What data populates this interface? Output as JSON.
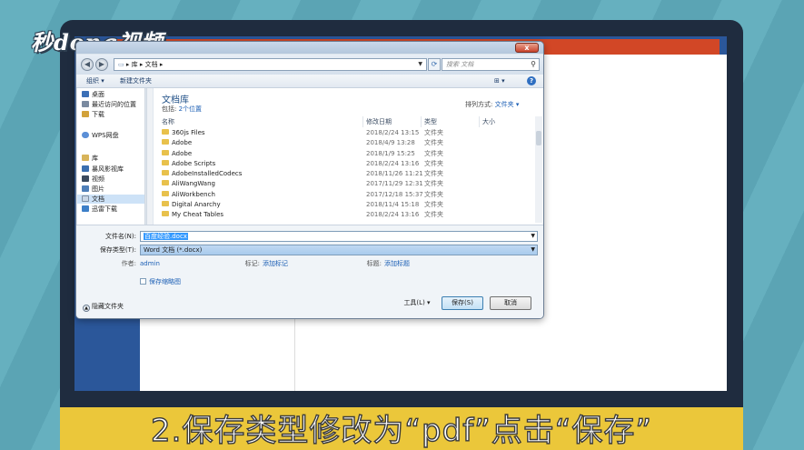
{
  "logo": "秒dong视频",
  "caption": "2.保存类型修改为“pdf”点击“保存”",
  "dialog": {
    "close": "x",
    "address": {
      "path": [
        "库",
        "文档"
      ],
      "separator": "▸"
    },
    "search_placeholder": "搜索 文档",
    "toolbar": {
      "organize": "组织 ▾",
      "new_folder": "新建文件夹",
      "view": "⊞ ▾",
      "help": "?"
    },
    "nav": [
      {
        "label": "桌面",
        "icon": "desktop-icon",
        "color": "#3b6fb6"
      },
      {
        "label": "最近访问的位置",
        "icon": "recent-places-icon",
        "color": "#7a8aa0"
      },
      {
        "label": "下载",
        "icon": "downloads-icon",
        "color": "#d2a23a"
      },
      {
        "label": "WPS网盘",
        "icon": "wps-cloud-icon",
        "color": "#5b8fd6"
      },
      {
        "label": "库",
        "icon": "libraries-icon",
        "color": "#d8b45a"
      },
      {
        "label": "暴风影视库",
        "icon": "video-library-icon",
        "color": "#3a6fb0"
      },
      {
        "label": "视频",
        "icon": "video-icon",
        "color": "#3a4a5e"
      },
      {
        "label": "图片",
        "icon": "pictures-icon",
        "color": "#4f7fb8"
      },
      {
        "label": "文档",
        "icon": "documents-icon",
        "color": "#c9d6e6"
      },
      {
        "label": "迅雷下载",
        "icon": "xunlei-download-icon",
        "color": "#3d7fc8"
      }
    ],
    "library": {
      "title": "文档库",
      "includes_prefix": "包括:",
      "includes_link": "2个位置",
      "arrange_prefix": "排列方式:",
      "arrange_value": "文件夹 ▾"
    },
    "columns": {
      "name": "名称",
      "date": "修改日期",
      "type": "类型",
      "size": "大小"
    },
    "files": [
      {
        "name": "360js Files",
        "date": "2018/2/24 13:15",
        "type": "文件夹"
      },
      {
        "name": "Adobe",
        "date": "2018/4/9 13:28",
        "type": "文件夹"
      },
      {
        "name": "Adobe",
        "date": "2018/1/9 15:25",
        "type": "文件夹"
      },
      {
        "name": "Adobe Scripts",
        "date": "2018/2/24 13:16",
        "type": "文件夹"
      },
      {
        "name": "AdobeInstalledCodecs",
        "date": "2018/11/26 11:21",
        "type": "文件夹"
      },
      {
        "name": "AliWangWang",
        "date": "2017/11/29 12:31",
        "type": "文件夹"
      },
      {
        "name": "AliWorkbench",
        "date": "2017/12/18 15:37",
        "type": "文件夹"
      },
      {
        "name": "Digital Anarchy",
        "date": "2018/11/4 15:18",
        "type": "文件夹"
      },
      {
        "name": "My Cheat Tables",
        "date": "2018/2/24 13:16",
        "type": "文件夹"
      }
    ],
    "form": {
      "filename_label": "文件名(N):",
      "filename_value": "百度经验.docx",
      "filetype_label": "保存类型(T):",
      "filetype_value": "Word 文档 (*.docx)",
      "author_label": "作者:",
      "author_value": "admin",
      "tags_label": "标记:",
      "tags_value": "添加标记",
      "title_label": "标题:",
      "title_value": "添加标题",
      "thumbnail_label": "保存缩略图",
      "hide_folders": "隐藏文件夹",
      "tools": "工具(L) ▾",
      "save": "保存(S)",
      "cancel": "取消"
    }
  }
}
